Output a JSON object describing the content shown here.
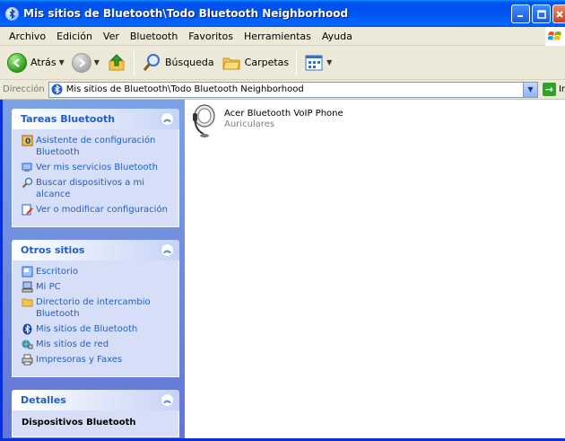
{
  "window": {
    "title": "Mis sitios de Bluetooth\\Todo Bluetooth Neighborhood"
  },
  "menu": {
    "items": [
      "Archivo",
      "Edición",
      "Ver",
      "Bluetooth",
      "Favoritos",
      "Herramientas",
      "Ayuda"
    ]
  },
  "toolbar": {
    "back_label": "Atrás",
    "search_label": "Búsqueda",
    "folders_label": "Carpetas"
  },
  "address": {
    "label": "Dirección",
    "value": "Mis sitios de Bluetooth\\Todo Bluetooth Neighborhood",
    "go_label": "Ir"
  },
  "taskpane": {
    "bluetooth_tasks": {
      "title": "Tareas Bluetooth",
      "items": [
        "Asistente de configuración Bluetooth",
        "Ver mis servicios Bluetooth",
        "Buscar dispositivos a mi alcance",
        "Ver o modificar configuración"
      ]
    },
    "other_places": {
      "title": "Otros sitios",
      "items": [
        "Escritorio",
        "Mi PC",
        "Directorio de intercambio Bluetooth",
        "Mis sitios de Bluetooth",
        "Mis sitios de red",
        "Impresoras y Faxes"
      ]
    },
    "details": {
      "title": "Detalles",
      "text": "Dispositivos Bluetooth"
    }
  },
  "devices": [
    {
      "name": "Acer Bluetooth VoIP Phone",
      "type": "Auriculares",
      "icon": "headset-icon"
    }
  ]
}
